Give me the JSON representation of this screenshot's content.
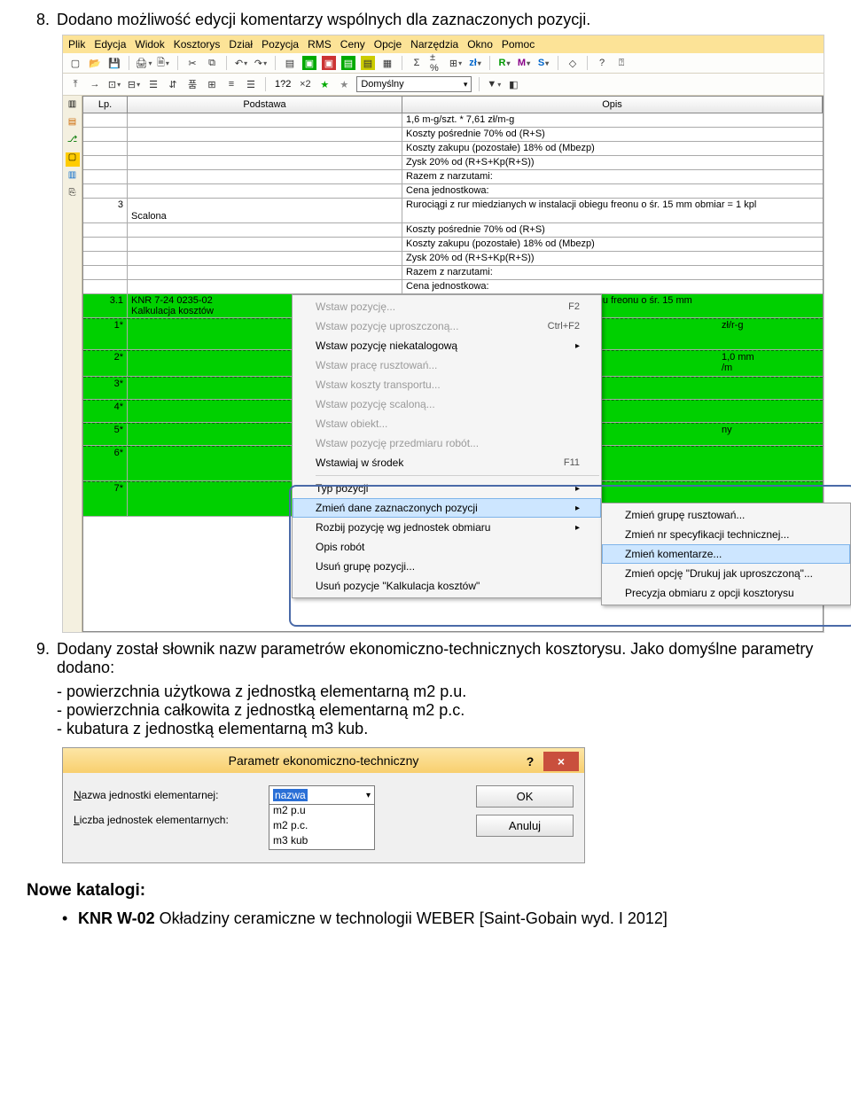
{
  "item8": {
    "num": "8.",
    "text": "Dodano możliwość edycji komentarzy wspólnych dla zaznaczonych pozycji."
  },
  "menubar": [
    "Plik",
    "Edycja",
    "Widok",
    "Kosztorys",
    "Dział",
    "Pozycja",
    "RMS",
    "Ceny",
    "Opcje",
    "Narzędzia",
    "Okno",
    "Pomoc"
  ],
  "tb2_combo": "Domyślny",
  "tb2_num": "1?2",
  "gridhead": {
    "lp": "Lp.",
    "pod": "Podstawa",
    "op": "Opis"
  },
  "rows": [
    {
      "lp": "",
      "pod": "",
      "op": "1,6 m-g/szt. * 7,61 zł/m-g"
    },
    {
      "lp": "",
      "pod": "",
      "op": "Koszty pośrednie  70% od (R+S)"
    },
    {
      "lp": "",
      "pod": "",
      "op": "Koszty zakupu (pozostałe)  18% od (Mbezp)"
    },
    {
      "lp": "",
      "pod": "",
      "op": "Zysk  20% od (R+S+Kp(R+S))"
    },
    {
      "lp": "",
      "pod": "",
      "op": "Razem z narzutami:"
    },
    {
      "lp": "",
      "pod": "",
      "op": "Cena jednostkowa:"
    },
    {
      "lp": "3",
      "pod": "Scalona",
      "op": "Rurociągi z rur miedzianych w instalacji obiegu freonu o śr. 15 mm obmiar  = 1 kpl"
    },
    {
      "lp": "",
      "pod": "",
      "op": "Koszty pośrednie  70% od (R+S)"
    },
    {
      "lp": "",
      "pod": "",
      "op": "Koszty zakupu (pozostałe)  18% od (Mbezp)"
    },
    {
      "lp": "",
      "pod": "",
      "op": "Zysk  20% od (R+S+Kp(R+S))"
    },
    {
      "lp": "",
      "pod": "",
      "op": "Razem z narzutami:"
    },
    {
      "lp": "",
      "pod": "",
      "op": "Cena jednostkowa:"
    }
  ],
  "selrow": {
    "lp": "3.1",
    "pod": "KNR 7-24 0235-02\nKalkulacja kosztów",
    "op": "Rurociągi z rur miedzianych w instalacji obiegu freonu o śr. 15 mm\nobmiar  = 40 kg"
  },
  "greens": [
    "1*",
    "2*",
    "3*",
    "4*",
    "5*",
    "6*",
    "7*"
  ],
  "greenop": {
    "g1": "zł/r-g",
    "g2a": "1,0 mm",
    "g2b": "/m",
    "g5": "ny"
  },
  "ctx": {
    "i1": "Wstaw pozycję...",
    "s1": "F2",
    "i2": "Wstaw pozycję uproszczoną...",
    "s2": "Ctrl+F2",
    "i3": "Wstaw pozycję niekatalogową",
    "i4": "Wstaw pracę rusztowań...",
    "i5": "Wstaw koszty transportu...",
    "i6": "Wstaw pozycję scaloną...",
    "i7": "Wstaw obiekt...",
    "i8": "Wstaw pozycję przedmiaru robót...",
    "i9": "Wstawiaj w środek",
    "s9": "F11",
    "i10": "Typ pozycji",
    "i11": "Zmień dane zaznaczonych pozycji",
    "i12": "Rozbij pozycję wg jednostek obmiaru",
    "i13": "Opis robót",
    "i14": "Usuń grupę pozycji...",
    "i15": "Usuń pozycje \"Kalkulacja kosztów\""
  },
  "sub": {
    "s1": "Zmień grupę rusztowań...",
    "s2": "Zmień nr specyfikacji technicznej...",
    "s3": "Zmień komentarze...",
    "s4": "Zmień opcję \"Drukuj jak uproszczoną\"...",
    "s5": "Precyzja obmiaru z opcji kosztorysu"
  },
  "item9": {
    "num": "9.",
    "text": "Dodany został słownik nazw parametrów ekonomiczno-technicznych kosztorysu. Jako domyślne parametry dodano:",
    "b1": "- powierzchnia użytkowa z jednostką elementarną m2 p.u.",
    "b2": "- powierzchnia całkowita z jednostką elementarną m2 p.c.",
    "b3": "- kubatura z jednostką elementarną m3 kub."
  },
  "dlg": {
    "title": "Parametr ekonomiczno-techniczny",
    "l1a": "N",
    "l1b": "azwa jednostki elementarnej:",
    "l2a": "L",
    "l2b": "iczba jednostek elementarnych:",
    "val": "nazwa",
    "opts": [
      "m2 p.u",
      "m2 p.c.",
      "m3 kub"
    ],
    "ok": "OK",
    "cancel": "Anuluj",
    "q": "?",
    "x": "×"
  },
  "nk": "Nowe katalogi:",
  "cat": {
    "dot": "•",
    "b": "KNR W-02",
    "rest": " Okładziny ceramiczne w technologii WEBER [Saint-Gobain wyd. I 2012]"
  }
}
